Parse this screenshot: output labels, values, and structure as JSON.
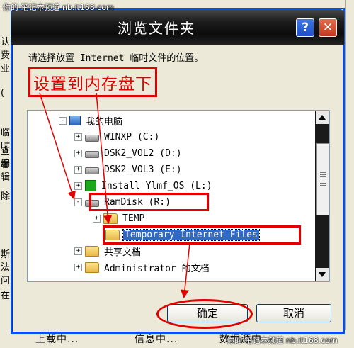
{
  "background": {
    "left_fragments": [
      "认费",
      "业",
      "(",
      "临时",
      "查看",
      "编辑",
      "除",
      "斯",
      "法问",
      "在"
    ],
    "bottom_fragments": [
      "上载中...",
      "信息中...",
      "数据源中..."
    ],
    "watermark_top": "你的·笔记本频道  nb.it168.com",
    "watermark_bottom": "你的·笔记本频道  nb.it168.com"
  },
  "dialog": {
    "title": "浏览文件夹",
    "help_label": "?",
    "close_label": "✕",
    "prompt": "请选择放置 Internet 临时文件的位置。",
    "annotation": "设置到内存盘下",
    "ok_label": "确定",
    "cancel_label": "取消",
    "annotation_color": "#e00000",
    "selection_color": "#316ac5"
  },
  "tree": {
    "items": [
      {
        "label": "我的电脑",
        "icon": "computer-icon",
        "expander": "-"
      },
      {
        "label": "WINXP (C:)",
        "icon": "drive-icon",
        "expander": "+"
      },
      {
        "label": "DSK2_VOL2 (D:)",
        "icon": "drive-icon",
        "expander": "+"
      },
      {
        "label": "DSK2_VOL3 (E:)",
        "icon": "drive-icon",
        "expander": "+"
      },
      {
        "label": "Install Ylmf_OS (L:)",
        "icon": "cd-drive-icon",
        "expander": "+"
      },
      {
        "label": "RamDisk (R:)",
        "icon": "drive-icon",
        "expander": "-"
      },
      {
        "label": "TEMP",
        "icon": "folder-icon",
        "expander": "+"
      },
      {
        "label": "Temporary Internet Files",
        "icon": "folder-icon",
        "expander": ""
      },
      {
        "label": "共享文档",
        "icon": "folder-icon",
        "expander": "+"
      },
      {
        "label": "Administrator 的文档",
        "icon": "folder-icon",
        "expander": "+"
      }
    ]
  }
}
